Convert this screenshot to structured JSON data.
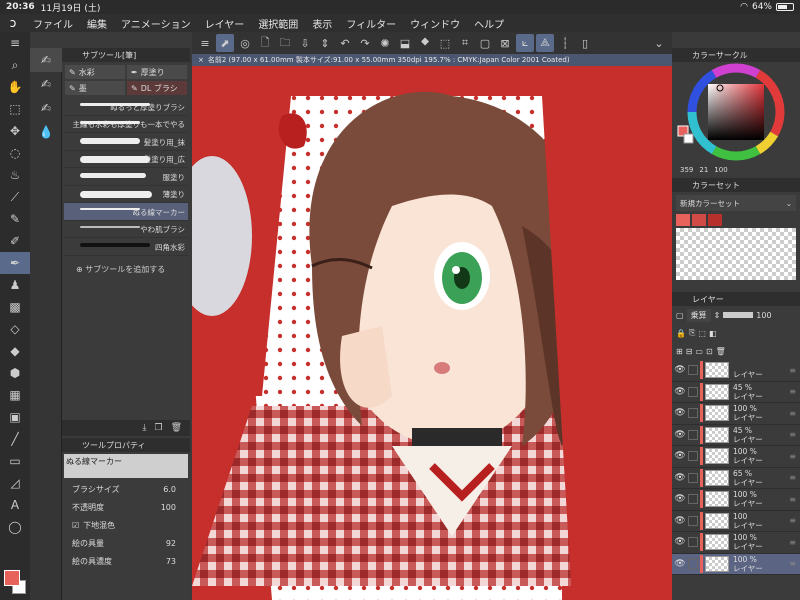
{
  "status": {
    "time": "20:36",
    "date": "11月19日 (土)",
    "battery": "64%",
    "wifi": "wifi-icon"
  },
  "menu": [
    "ファイル",
    "編集",
    "アニメーション",
    "レイヤー",
    "選択範囲",
    "表示",
    "フィルター",
    "ウィンドウ",
    "ヘルプ"
  ],
  "canvas_tab": "名前2 (97.00 x 61.00mm 製本サイズ:91.00 x 55.00mm 350dpi 195.7% : CMYK:Japan Color 2001 Coated)",
  "subtool": {
    "title": "サブツール[筆]",
    "tabs": [
      "水彩",
      "厚塗り",
      "墨",
      "DL ブラシ"
    ],
    "brushes": [
      "ぬるっと厚塗りブラシ",
      "主線も水彩も厚塗りも一本でやる",
      "髪塗り用_抹",
      "髪塗り用_広",
      "服塗り",
      "薄塗り",
      "ぬる線マーカー",
      "やわ肌ブラシ",
      "四角水彩"
    ],
    "add_label": "サブツールを追加する"
  },
  "toolprop": {
    "title": "ツールプロパティ",
    "brush_name": "ぬる線マーカー",
    "rows": [
      {
        "label": "ブラシサイズ",
        "value": "6.0"
      },
      {
        "label": "不透明度",
        "value": "100"
      },
      {
        "label": "下地混色",
        "value": ""
      },
      {
        "label": "絵の具量",
        "value": "92"
      },
      {
        "label": "絵の具濃度",
        "value": "73"
      }
    ]
  },
  "colorcircle": {
    "title": "カラーサークル",
    "h": "359",
    "s": "21",
    "v": "100"
  },
  "colorset": {
    "title": "カラーセット",
    "name": "新規カラーセット",
    "colors": [
      "#e8625c",
      "#d24a45",
      "#b8302c"
    ]
  },
  "layers": {
    "title": "レイヤー",
    "blend": "乗算",
    "opacity": "100",
    "items": [
      {
        "pct": "",
        "name": "レイヤー"
      },
      {
        "pct": "45 %",
        "name": "レイヤー"
      },
      {
        "pct": "100 %",
        "name": "レイヤー"
      },
      {
        "pct": "45 %",
        "name": "レイヤー"
      },
      {
        "pct": "100 %",
        "name": "レイヤー"
      },
      {
        "pct": "65 %",
        "name": "レイヤー"
      },
      {
        "pct": "100 %",
        "name": "レイヤー"
      },
      {
        "pct": "100",
        "name": "レイヤー"
      },
      {
        "pct": "100 %",
        "name": "レイヤー"
      },
      {
        "pct": "100 %",
        "name": "レイヤー"
      }
    ]
  },
  "colors": {
    "accent": "#5a6a8a",
    "main_color": "#e8625c",
    "canvas_bg": "#c62f2b"
  }
}
